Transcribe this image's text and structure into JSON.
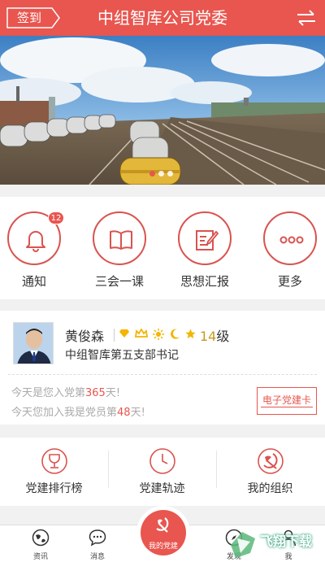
{
  "header": {
    "signin_label": "签到",
    "title": "中组智库公司党委"
  },
  "features": [
    {
      "label": "通知",
      "badge": "12"
    },
    {
      "label": "三会一课"
    },
    {
      "label": "思想汇报"
    },
    {
      "label": "更多"
    }
  ],
  "profile": {
    "name": "黄俊森",
    "level_num": "14",
    "level_suffix": "级",
    "role": "中组智库第五支部书记",
    "join_prefix": "今天是您入党第",
    "join_days": "365",
    "join_suffix": "天!",
    "member_prefix": "今天您加入我是党员第",
    "member_days": "48",
    "member_suffix": "天!",
    "card_button": "电子党建卡"
  },
  "lower": [
    {
      "label": "党建排行榜"
    },
    {
      "label": "党建轨迹"
    },
    {
      "label": "我的组织"
    }
  ],
  "tabbar": {
    "news": "资讯",
    "messages": "消息",
    "center": "我的党建",
    "discover": "发现",
    "mine": "我"
  },
  "watermark": "飞翔下载",
  "colors": {
    "accent": "#e8564f",
    "gold": "#f4b400"
  }
}
